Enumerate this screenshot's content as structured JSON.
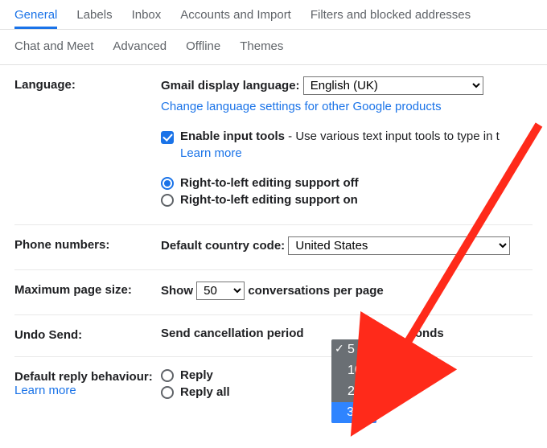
{
  "tabs": {
    "row1": [
      "General",
      "Labels",
      "Inbox",
      "Accounts and Import",
      "Filters and blocked addresses"
    ],
    "row2": [
      "Chat and Meet",
      "Advanced",
      "Offline",
      "Themes"
    ],
    "active": "General"
  },
  "language": {
    "section_label": "Language:",
    "display_label": "Gmail display language:",
    "selected": "English (UK)",
    "change_link": "Change language settings for other Google products",
    "input_tools_label": "Enable input tools",
    "input_tools_desc": " - Use various text input tools to type in t",
    "learn_more": "Learn more",
    "rtl_off": "Right-to-left editing support off",
    "rtl_on": "Right-to-left editing support on"
  },
  "phone": {
    "section_label": "Phone numbers:",
    "label": "Default country code:",
    "selected": "United States"
  },
  "pagesize": {
    "section_label": "Maximum page size:",
    "prefix": "Show",
    "selected": "50",
    "suffix": "conversations per page"
  },
  "undo": {
    "section_label": "Undo Send:",
    "prefix": "Send cancellation period",
    "suffix": "onds",
    "options": [
      "5",
      "10",
      "20",
      "30"
    ],
    "current": "5",
    "highlight": "30"
  },
  "reply": {
    "section_label": "Default reply behaviour:",
    "learn_more": "Learn more",
    "opt1": "Reply",
    "opt2": "Reply all"
  }
}
